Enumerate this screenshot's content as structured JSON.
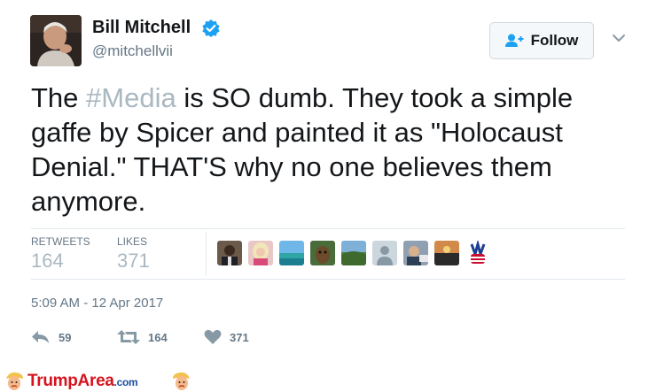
{
  "user": {
    "name": "Bill Mitchell",
    "handle": "@mitchellvii",
    "verified": true
  },
  "follow_button": {
    "label": "Follow",
    "icon": "add-user-icon"
  },
  "tweet": {
    "text_before": "The ",
    "hashtag": "#Media",
    "text_after": " is SO dumb.  They took a simple gaffe by Spicer and painted it as \"Holocaust Denial.\"  THAT'S why no one believes them anymore."
  },
  "stats": {
    "retweets_label": "RETWEETS",
    "retweets_value": "164",
    "likes_label": "LIKES",
    "likes_value": "371"
  },
  "likers_count": 9,
  "timestamp": "5:09 AM - 12 Apr 2017",
  "actions": {
    "reply_count": "59",
    "retweet_count": "164",
    "like_count": "371"
  },
  "footer": {
    "brand_main": "TrumpArea",
    "brand_suffix": ".com"
  },
  "colors": {
    "text": "#14171a",
    "muted": "#657786",
    "hashtag": "#aab8c2",
    "verified": "#1da1f2",
    "brand": "#d6141f"
  }
}
